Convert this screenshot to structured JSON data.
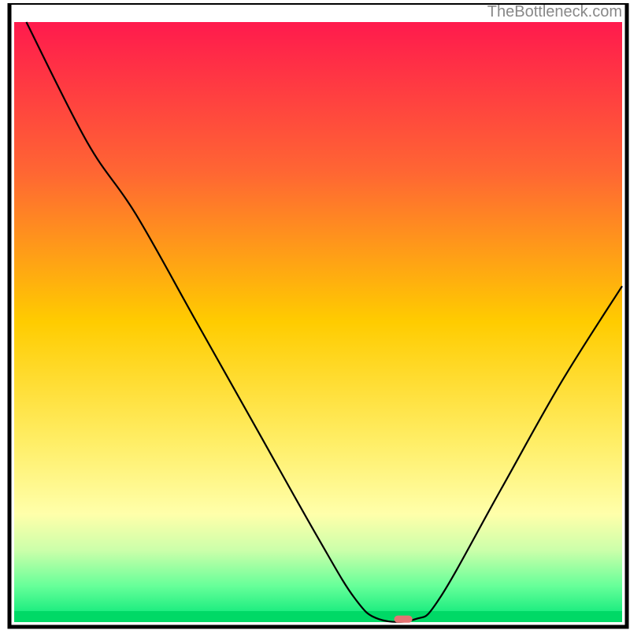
{
  "watermark": "TheBottleneck.com",
  "chart_data": {
    "type": "line",
    "title": "",
    "xlabel": "",
    "ylabel": "",
    "xlim": [
      0,
      100
    ],
    "ylim": [
      0,
      100
    ],
    "background_gradient": {
      "type": "vertical",
      "stops": [
        {
          "offset": 0,
          "color": "#ff1a4d"
        },
        {
          "offset": 0.25,
          "color": "#ff6633"
        },
        {
          "offset": 0.5,
          "color": "#ffcc00"
        },
        {
          "offset": 0.7,
          "color": "#ffee66"
        },
        {
          "offset": 0.82,
          "color": "#ffffaa"
        },
        {
          "offset": 0.88,
          "color": "#ccffaa"
        },
        {
          "offset": 0.94,
          "color": "#66ff99"
        },
        {
          "offset": 1.0,
          "color": "#00e676"
        }
      ]
    },
    "series": [
      {
        "name": "curve",
        "color": "#000000",
        "points": [
          {
            "x": 2,
            "y": 100
          },
          {
            "x": 12,
            "y": 80
          },
          {
            "x": 20,
            "y": 68
          },
          {
            "x": 30,
            "y": 50
          },
          {
            "x": 40,
            "y": 32
          },
          {
            "x": 50,
            "y": 14
          },
          {
            "x": 56,
            "y": 4
          },
          {
            "x": 60,
            "y": 0.5
          },
          {
            "x": 66,
            "y": 0.5
          },
          {
            "x": 70,
            "y": 4
          },
          {
            "x": 80,
            "y": 22
          },
          {
            "x": 90,
            "y": 40
          },
          {
            "x": 100,
            "y": 56
          }
        ]
      }
    ],
    "marker": {
      "x": 64,
      "y": 0.5,
      "color": "#e57373",
      "width": 3,
      "height": 1.2
    },
    "frame_color": "#000000"
  }
}
